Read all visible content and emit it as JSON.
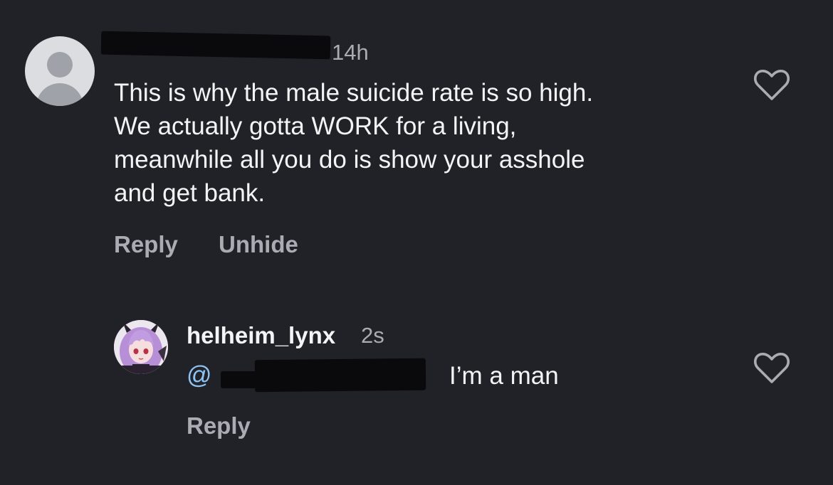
{
  "comments": [
    {
      "time": "14h",
      "text": "This is why the male suicide rate is so high.\nWe actually gotta WORK for a living,\nmeanwhile all you do is show your asshole\nand get bank.",
      "actions": {
        "reply": "Reply",
        "unhide": "Unhide"
      },
      "like_icon": "heart-outline-icon",
      "avatar_icon": "default-user-avatar-icon"
    },
    {
      "username": "helheim_lynx",
      "time": "2s",
      "mention_prefix": "@",
      "text": "I’m a man",
      "actions": {
        "reply": "Reply"
      },
      "like_icon": "heart-outline-icon",
      "avatar_icon": "anime-girl-avatar-icon"
    }
  ],
  "colors": {
    "background": "#212228",
    "primary_text": "#f4f4f6",
    "secondary_text": "#a9acb3",
    "mention": "#8ec3f5",
    "redaction": "#0a0a0c"
  }
}
